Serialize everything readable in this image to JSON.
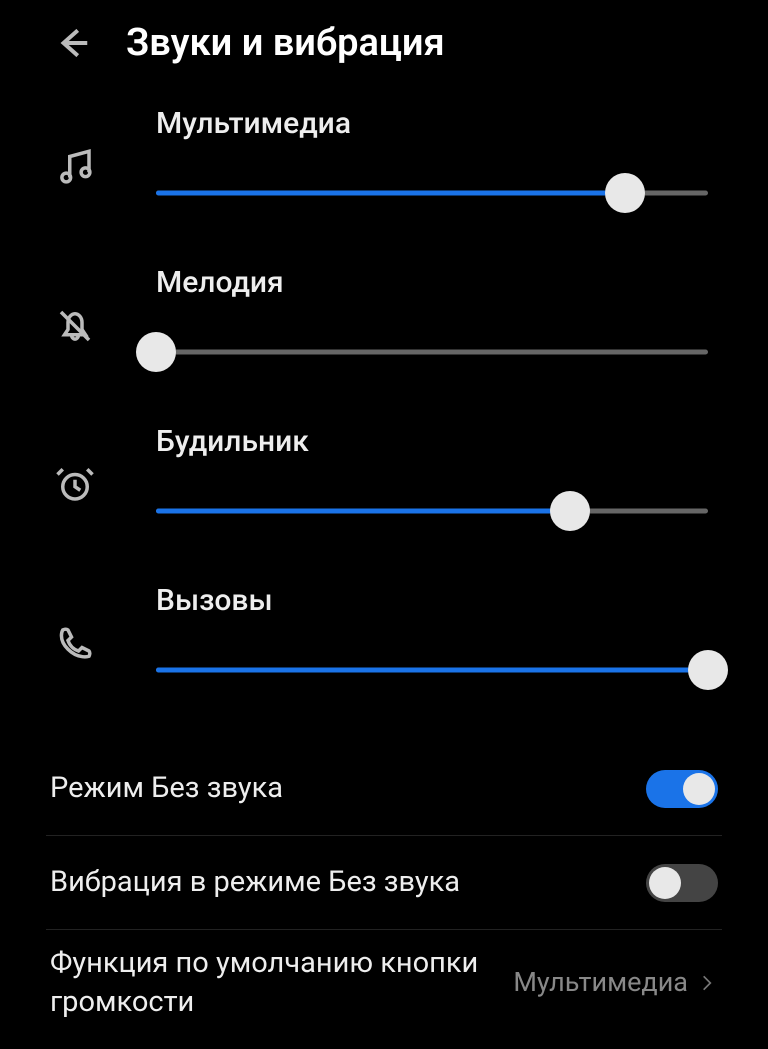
{
  "header": {
    "title": "Звуки и вибрация"
  },
  "sliders": {
    "media": {
      "label": "Мультимедиа",
      "value": 85
    },
    "ringtone": {
      "label": "Мелодия",
      "value": 0
    },
    "alarm": {
      "label": "Будильник",
      "value": 75
    },
    "calls": {
      "label": "Вызовы",
      "value": 100
    }
  },
  "toggles": {
    "silent": {
      "label": "Режим Без звука",
      "on": true
    },
    "vibrate_silent": {
      "label": "Вибрация в режиме Без звука",
      "on": false
    }
  },
  "volume_key_default": {
    "label": "Функция по умолчанию кнопки громкости",
    "value": "Мультимедиа"
  },
  "colors": {
    "accent": "#1a73e8"
  }
}
